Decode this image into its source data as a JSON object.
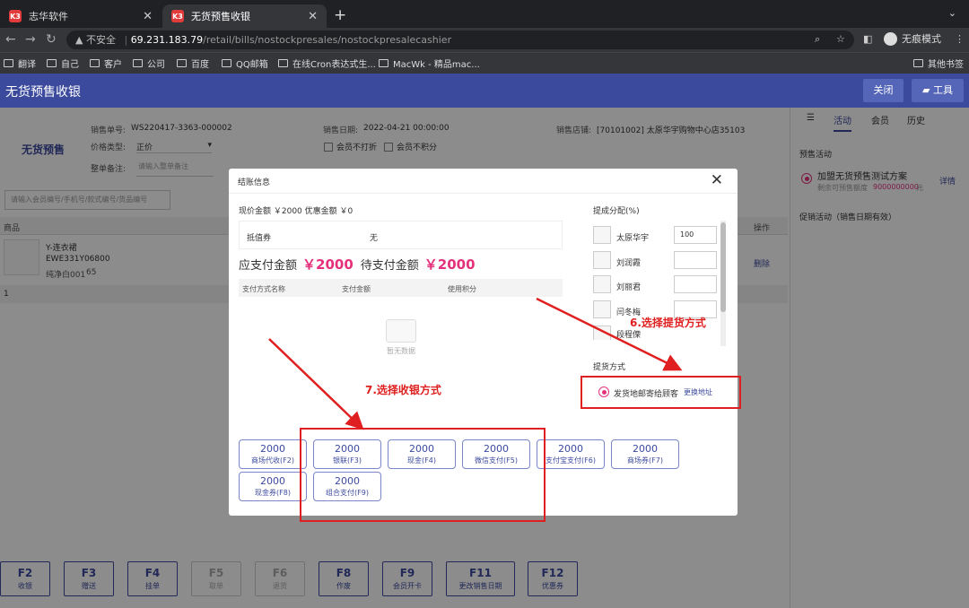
{
  "browser": {
    "tabs": [
      {
        "favicon": "K3",
        "title": "志华软件"
      },
      {
        "favicon": "K3",
        "title": "无货预售收银"
      }
    ],
    "security_label": "不安全",
    "url_host": "69.231.183.79",
    "url_path": "/retail/bills/nostockpresales/nostockpresalecashier",
    "profile_label": "无痕模式",
    "bookmarks": [
      "翻译",
      "自己",
      "客户",
      "公司",
      "百度",
      "QQ邮箱",
      "在线Cron表达式生...",
      "MacWk - 精品mac..."
    ],
    "other_bookmarks": "其他书签"
  },
  "app": {
    "title": "无货预售收银",
    "close_label": "关闭",
    "tools_label": "工具"
  },
  "form": {
    "mode_title": "无货预售",
    "sale_no_label": "销售单号:",
    "sale_no": "WS220417-3363-000002",
    "sale_date_label": "销售日期:",
    "sale_date": "2022-04-21 00:00:00",
    "store_label": "销售店铺:",
    "store": "[70101002] 太原华宇购物中心店35103",
    "price_type_label": "价格类型:",
    "price_type": "正价",
    "opt_no_print": "会员不打折",
    "opt_no_points": "会员不积分",
    "remark_label": "整单备注:",
    "remark_placeholder": "请输入整单备注",
    "search_placeholder": "请输入会员编号/手机号/款式编号/货品编号"
  },
  "table": {
    "col_product": "商品",
    "col_action": "操作",
    "product_name": "Y-连衣裙",
    "product_code": "EWE331Y06800",
    "product_variant": "纯净白001",
    "product_size": "65",
    "delete_label": "删除",
    "total_row": "1"
  },
  "right_panel": {
    "tabs": [
      "活动",
      "会员",
      "历史"
    ],
    "presale_title": "预售活动",
    "presale_name": "加盟无货预售测试方案",
    "presale_remain_label": "剩余可预售额度",
    "presale_remain": "9000000000",
    "presale_unit": "元",
    "detail_label": "详情",
    "promo_title": "促销活动（销售日期有效）"
  },
  "fkeys": [
    {
      "key": "F2",
      "label": "收银",
      "enabled": true
    },
    {
      "key": "F3",
      "label": "赠送",
      "enabled": true
    },
    {
      "key": "F4",
      "label": "挂单",
      "enabled": true
    },
    {
      "key": "F5",
      "label": "取单",
      "enabled": false
    },
    {
      "key": "F6",
      "label": "退货",
      "enabled": false
    },
    {
      "key": "F8",
      "label": "作废",
      "enabled": true
    },
    {
      "key": "F9",
      "label": "会员开卡",
      "enabled": true
    },
    {
      "key": "F11",
      "label": "更改销售日期",
      "enabled": true
    },
    {
      "key": "F12",
      "label": "优惠券",
      "enabled": true
    }
  ],
  "modal": {
    "title": "结账信息",
    "price_summary": "现价金额 ￥2000  优惠金额 ￥0",
    "voucher_label": "抵值券",
    "voucher_value": "无",
    "payable_label": "应支付金额",
    "payable": "￥2000",
    "pending_label": "待支付金额",
    "pending": "￥2000",
    "pay_cols": [
      "支付方式名称",
      "支付金额",
      "使用积分"
    ],
    "no_data": "暂无数据",
    "pay_methods": [
      {
        "amount": "2000",
        "name": "商场代收(F2)"
      },
      {
        "amount": "2000",
        "name": "银联(F3)"
      },
      {
        "amount": "2000",
        "name": "现金(F4)"
      },
      {
        "amount": "2000",
        "name": "微信支付(F5)"
      },
      {
        "amount": "2000",
        "name": "支付宝支付(F6)"
      },
      {
        "amount": "2000",
        "name": "商场券(F7)"
      },
      {
        "amount": "2000",
        "name": "现金券(F8)"
      },
      {
        "amount": "2000",
        "name": "组合支付(F9)"
      }
    ],
    "commission_title": "提成分配(%)",
    "staff": [
      {
        "name": "太原华宇",
        "value": "100"
      },
      {
        "name": "刘润霞",
        "value": ""
      },
      {
        "name": "刘丽君",
        "value": ""
      },
      {
        "name": "闫冬梅",
        "value": ""
      },
      {
        "name": "段程傈",
        "value": ""
      }
    ],
    "delivery_title": "提货方式",
    "delivery_option": "发货地邮寄给顾客",
    "change_address": "更换地址"
  },
  "annotations": {
    "step6": "6.选择提货方式",
    "step7": "7.选择收银方式"
  }
}
